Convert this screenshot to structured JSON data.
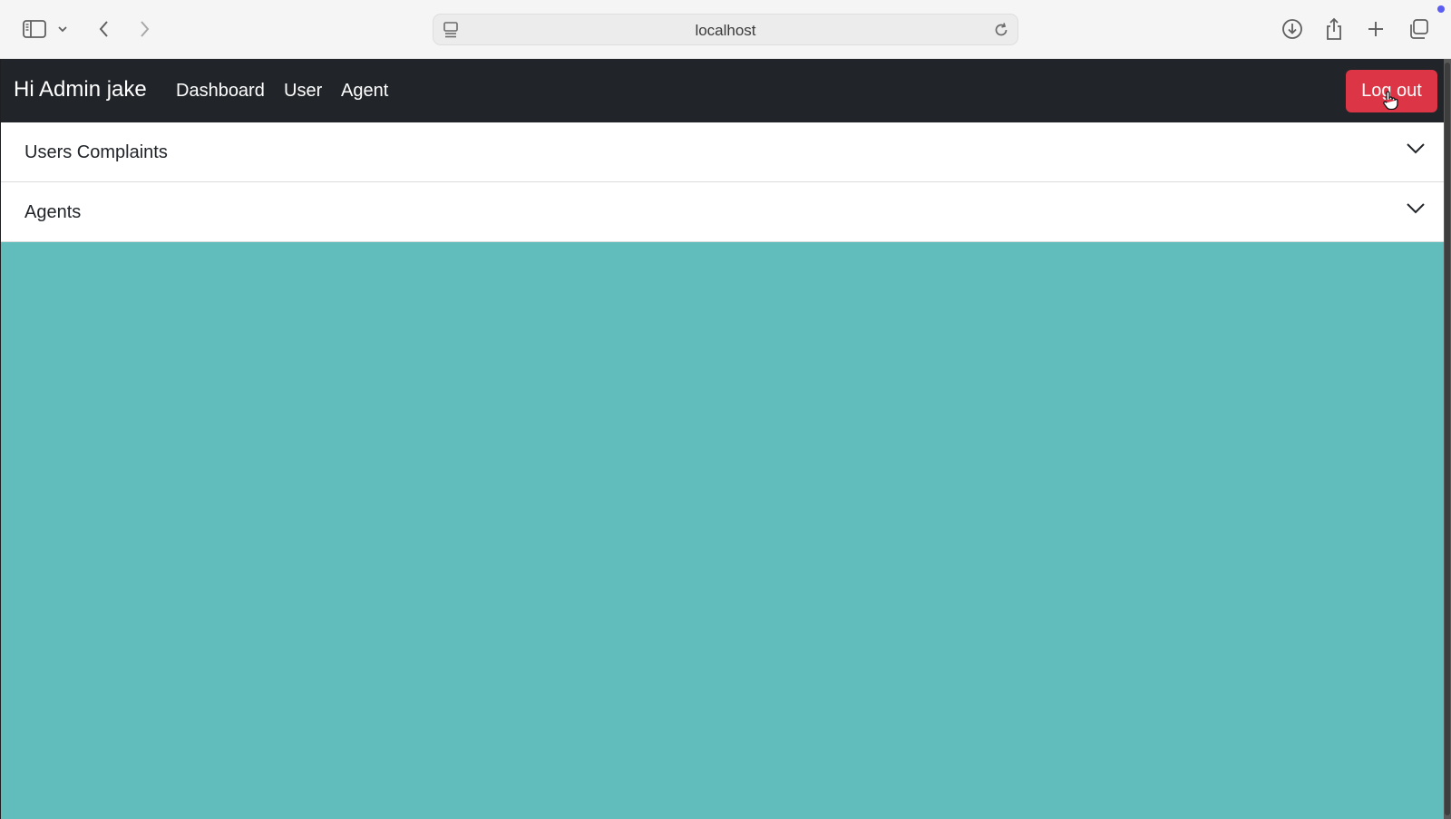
{
  "browser": {
    "address": "localhost"
  },
  "navbar": {
    "brand": "Hi Admin jake",
    "links": [
      "Dashboard",
      "User",
      "Agent"
    ],
    "logout_label": "Log out"
  },
  "accordion": {
    "items": [
      "Users Complaints",
      "Agents"
    ]
  },
  "colors": {
    "navbar_bg": "#212529",
    "page_bg": "#60bdbc",
    "logout_bg": "#dc3545"
  }
}
